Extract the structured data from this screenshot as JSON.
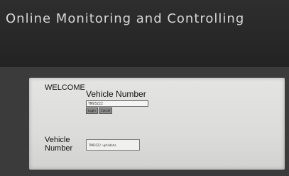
{
  "header": {
    "title": "Online Monitoring and Controlling"
  },
  "main": {
    "welcome": "WELCOME",
    "login": {
      "field_label": "Vehicle Number",
      "input_value": "TN93222",
      "login_button": "Login",
      "cancel_button": "Cancel"
    },
    "result": {
      "label": "Vehicle Number",
      "value": "TN93222 uptodate"
    }
  },
  "colors": {
    "header_bg": "#2b2b2b",
    "title_text": "#d7d7d7",
    "panel_bg": "#e0e0de"
  }
}
